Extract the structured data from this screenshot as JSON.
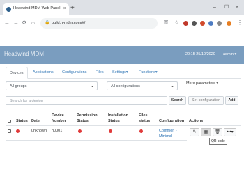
{
  "browser": {
    "tab_title": "Headwind MDM Web Panel",
    "tab_close": "×",
    "new_tab": "+",
    "minimize": "–",
    "maximize": "☐",
    "close": "×",
    "url": "build.h-mdm.com/#/"
  },
  "app": {
    "brand": "Headwind MDM",
    "datetime": "20:15 25/10/2020",
    "user": "admin"
  },
  "tabs": [
    {
      "label": "Devices"
    },
    {
      "label": "Applications"
    },
    {
      "label": "Configurations"
    },
    {
      "label": "Files"
    },
    {
      "label": "Settings"
    },
    {
      "label": "Functions"
    }
  ],
  "filters": {
    "group": "All groups",
    "configuration": "All configurations",
    "more": "More parameters"
  },
  "search": {
    "placeholder": "Search for a device",
    "search_button": "Search",
    "set_config_button": "Set configuration",
    "add_button": "Add"
  },
  "table": {
    "headers": {
      "status": "Status",
      "date": "Date",
      "device_line1": "Device",
      "device_line2": "Number",
      "permission_line1": "Permission",
      "permission_line2": "Status",
      "installation_line1": "Installation",
      "installation_line2": "Status",
      "files_line1": "Files",
      "files_line2": "status",
      "configuration": "Configuration",
      "actions": "Actions"
    },
    "rows": [
      {
        "date": "unknown",
        "device_number": "h0001",
        "config_line1": "Common -",
        "config_line2": "Minimal"
      }
    ],
    "status_color": "#e03a3a",
    "tooltip": "QR code"
  }
}
